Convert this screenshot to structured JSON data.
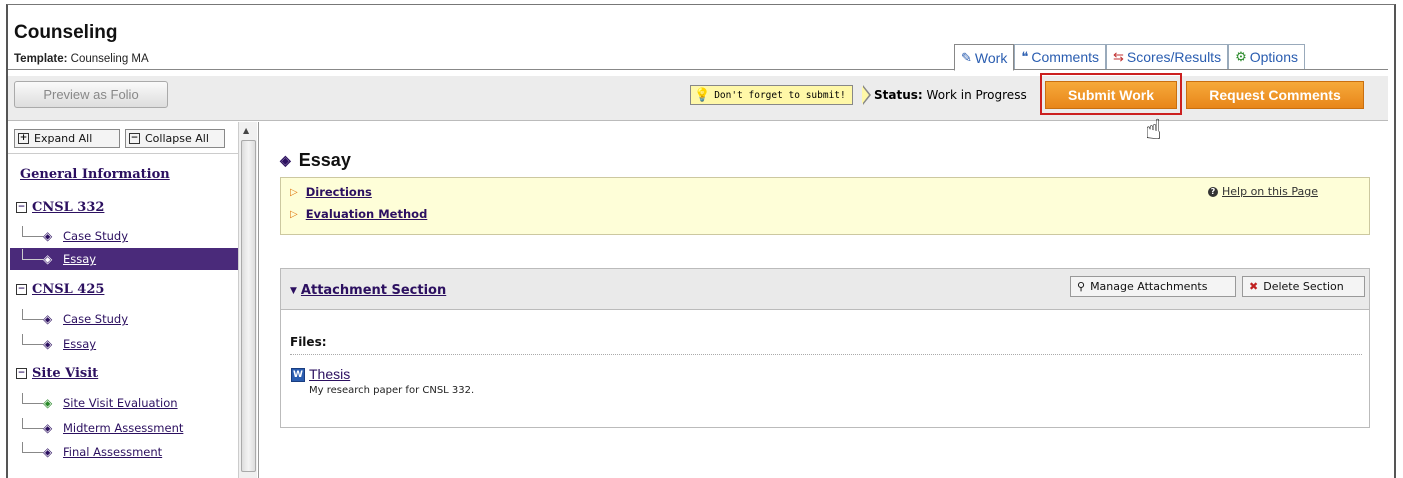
{
  "header": {
    "title": "Counseling",
    "template_label": "Template:",
    "template_value": "Counseling MA"
  },
  "tabs": [
    {
      "label": "Work",
      "icon": "pencil-icon",
      "active": true
    },
    {
      "label": "Comments",
      "icon": "quote-icon",
      "active": false
    },
    {
      "label": "Scores/Results",
      "icon": "scores-icon",
      "active": false
    },
    {
      "label": "Options",
      "icon": "options-icon",
      "active": false
    }
  ],
  "toolbar": {
    "preview_label": "Preview as Folio",
    "tip_text": "Don't forget to submit!",
    "status_label": "Status:",
    "status_value": "Work in Progress",
    "submit_label": "Submit Work",
    "request_label": "Request Comments"
  },
  "sidebar": {
    "expand_all": "Expand All",
    "collapse_all": "Collapse All",
    "general_info": "General Information",
    "sections": [
      {
        "title": "CNSL 332",
        "items": [
          {
            "label": "Case Study"
          },
          {
            "label": "Essay",
            "active": true
          }
        ]
      },
      {
        "title": "CNSL 425",
        "items": [
          {
            "label": "Case Study"
          },
          {
            "label": "Essay"
          }
        ]
      },
      {
        "title": "Site Visit",
        "items": [
          {
            "label": "Site Visit Evaluation"
          },
          {
            "label": "Midterm Assessment"
          },
          {
            "label": "Final Assessment"
          }
        ]
      }
    ]
  },
  "main": {
    "title": "Essay",
    "directions_label": "Directions",
    "evaluation_label": "Evaluation Method",
    "help_label": "Help on this Page",
    "attachment_section_title": "Attachment Section",
    "manage_attachments": "Manage Attachments",
    "delete_section": "Delete Section",
    "files_label": "Files:",
    "file_name": "Thesis",
    "file_description": "My research paper for CNSL 332."
  },
  "colors": {
    "accent_purple": "#4a2a7a",
    "submit_orange": "#e8861a",
    "tab_blue": "#2a5db0",
    "tip_yellow": "#fff8a8"
  }
}
